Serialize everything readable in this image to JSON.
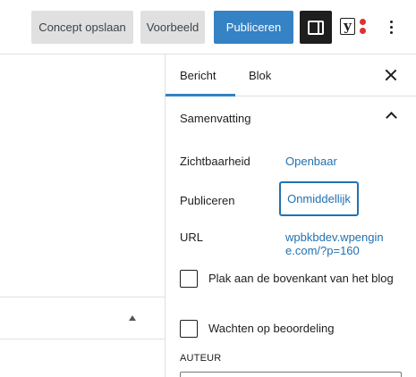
{
  "toolbar": {
    "save_draft_label": "Concept opslaan",
    "preview_label": "Voorbeeld",
    "publish_label": "Publiceren",
    "plugin_letter": "y",
    "icons": [
      "settings-icon",
      "yoast-icon",
      "more-options-icon"
    ],
    "colors": {
      "publish_bg": "#3582c4",
      "settings_bg": "#1e1e1e",
      "yoast_dot": "#dc3232"
    }
  },
  "sidebar": {
    "tabs": [
      {
        "label": "Bericht",
        "active": true
      },
      {
        "label": "Blok",
        "active": false
      }
    ],
    "panel": {
      "title": "Samenvatting",
      "expanded": true,
      "rows": {
        "visibility": {
          "label": "Zichtbaarheid",
          "value": "Openbaar"
        },
        "publish": {
          "label": "Publiceren",
          "value": "Onmiddellijk"
        },
        "url": {
          "label": "URL",
          "value": "wpbkbdev.wpengine.com/?p=160"
        }
      },
      "checkboxes": {
        "sticky": {
          "label": "Plak aan de bovenkant van het blog",
          "checked": false
        },
        "pending": {
          "label": "Wachten op beoordeling",
          "checked": false
        }
      },
      "author_heading": "AUTEUR"
    }
  },
  "editor": {
    "meta_box_expanded": true
  }
}
